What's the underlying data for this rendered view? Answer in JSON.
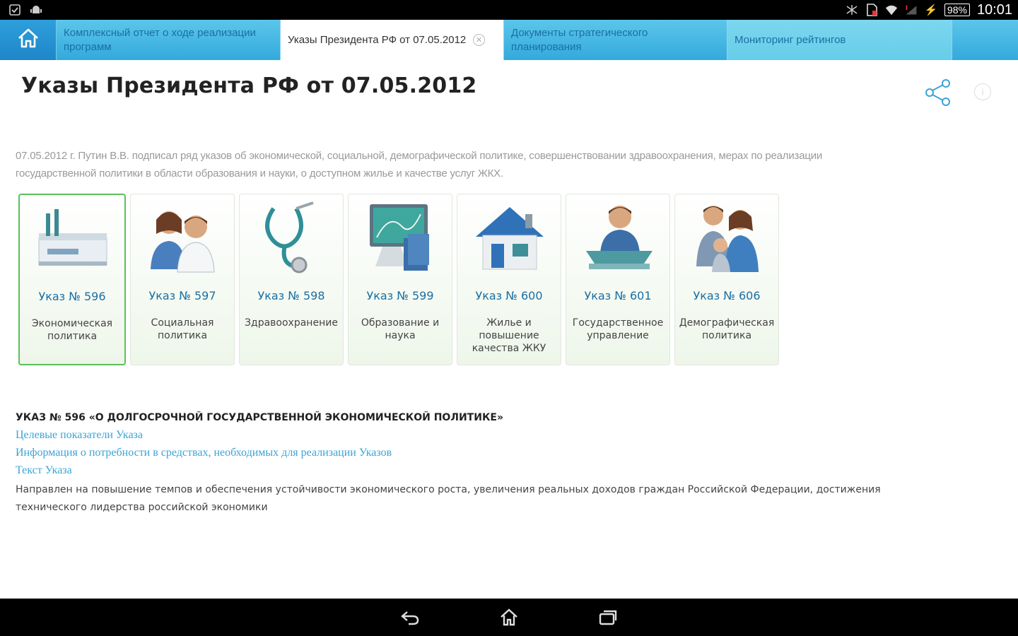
{
  "status_bar": {
    "time": "10:01",
    "battery": "98%",
    "left_icons": [
      "checkbox-icon",
      "android-icon"
    ],
    "right_icons": [
      "nfc-icon",
      "sim-card-icon",
      "wifi-icon",
      "signal-icon",
      "battery-icon"
    ]
  },
  "tabs": {
    "home_icon": "home-icon",
    "items": [
      {
        "label": "Комплексный отчет о ходе реализации программ",
        "active": false
      },
      {
        "label": "Указы Президента РФ от 07.05.2012",
        "active": true
      },
      {
        "label": "Документы стратегического планирования",
        "active": false
      },
      {
        "label": "Мониторинг рейтингов",
        "active": false
      }
    ]
  },
  "main": {
    "title": "Указы Президента РФ от 07.05.2012",
    "intro": "07.05.2012 г. Путин В.В. подписал ряд указов об экономической, социальной, демографической политике, совершенствовании здравоохранения, мерах по реализации государственной политики в области образования и науки, о доступном жилье и качестве услуг ЖКХ.",
    "cards": [
      {
        "number": "Указ № 596",
        "category": "Экономическая политика",
        "icon": "factory-icon",
        "selected": true
      },
      {
        "number": "Указ № 597",
        "category": "Социальная политика",
        "icon": "doctors-icon",
        "selected": false
      },
      {
        "number": "Указ № 598",
        "category": "Здравоохранение",
        "icon": "stethoscope-icon",
        "selected": false
      },
      {
        "number": "Указ № 599",
        "category": "Образование и наука",
        "icon": "computer-books-icon",
        "selected": false
      },
      {
        "number": "Указ № 600",
        "category": "Жилье и повышение качества ЖКУ",
        "icon": "house-icon",
        "selected": false
      },
      {
        "number": "Указ № 601",
        "category": "Государственное управление",
        "icon": "speaker-podium-icon",
        "selected": false
      },
      {
        "number": "Указ № 606",
        "category": "Демографическая политика",
        "icon": "family-icon",
        "selected": false
      }
    ]
  },
  "decree": {
    "heading": "УКАЗ № 596 «О ДОЛГОСРОЧНОЙ ГОСУДАРСТВЕННОЙ ЭКОНОМИЧЕСКОЙ ПОЛИТИКЕ»",
    "links": [
      "Целевые показатели Указа",
      "Информация о потребности в средствах, необходимых для реализации Указов",
      "Текст Указа"
    ],
    "description": "Направлен на повышение темпов и обеспечения устойчивости экономического роста, увеличения реальных доходов граждан Российской Федерации, достижения технического лидерства российской экономики"
  },
  "colors": {
    "tab_bar": "#33a9dc",
    "link": "#3aa4d6",
    "selected_card_border": "#5ac05a"
  }
}
